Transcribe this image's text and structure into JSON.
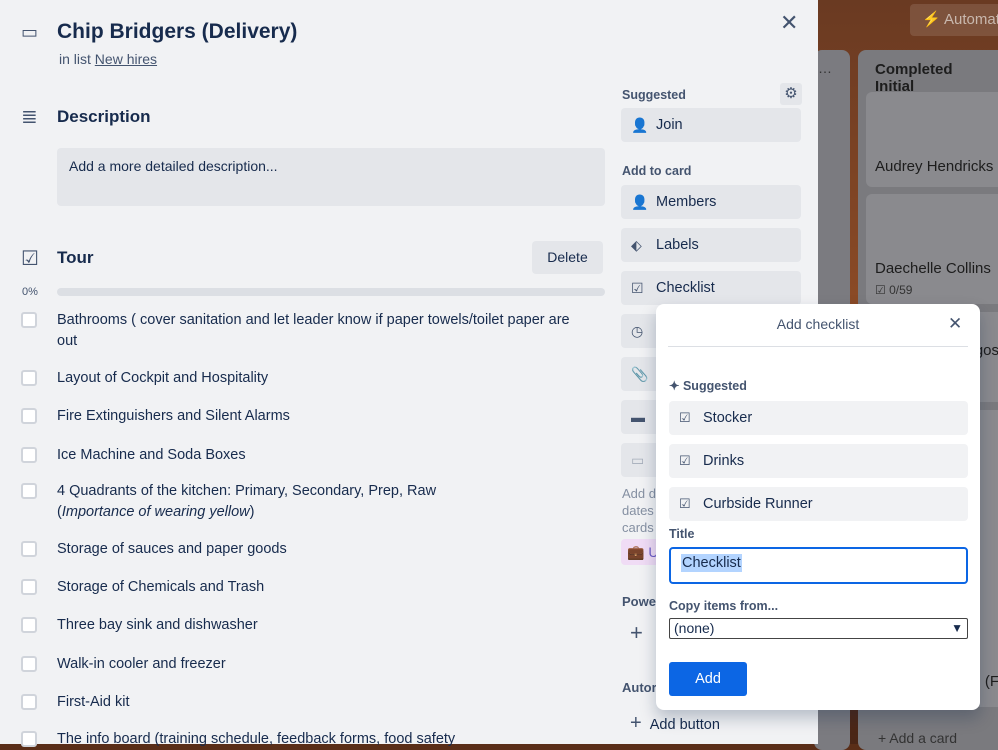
{
  "board": {
    "automation_label": "Automat",
    "list2_title": "Completed Initial",
    "cards": [
      {
        "title": "Audrey Hendricks"
      },
      {
        "title": "Daechelle Collins",
        "badge": "0/59"
      },
      {
        "title": "gos"
      },
      {
        "title": "(F"
      },
      {
        "title": "(F"
      }
    ],
    "add_card": "+ Add a card"
  },
  "card": {
    "title": "Chip Bridgers (Delivery)",
    "in_list_prefix": "in list",
    "list_name": "New hires"
  },
  "description": {
    "heading": "Description",
    "placeholder": "Add a more detailed description..."
  },
  "checklist": {
    "title": "Tour",
    "delete_label": "Delete",
    "progress_label": "0%",
    "progress": 0,
    "items": [
      {
        "text": "Bathrooms ( cover sanitation and let leader know if paper towels/toilet paper are out"
      },
      {
        "text": "Layout of Cockpit and Hospitality"
      },
      {
        "text": "Fire Extinguishers and Silent Alarms"
      },
      {
        "text": "Ice Machine and Soda Boxes"
      },
      {
        "text": "4 Quadrants of the kitchen: Primary, Secondary, Prep, Raw",
        "text_em": "Importance of wearing yellow"
      },
      {
        "text": "Storage of sauces and paper goods"
      },
      {
        "text": "Storage of Chemicals and Trash"
      },
      {
        "text": "Three bay sink and dishwasher"
      },
      {
        "text": "Walk-in cooler and freezer"
      },
      {
        "text": "First-Aid kit"
      },
      {
        "text": "The info board (training schedule, feedback forms, food safety"
      }
    ]
  },
  "sidebar": {
    "suggested_label": "Suggested",
    "join": "Join",
    "add_to_card_label": "Add to card",
    "members": "Members",
    "labels": "Labels",
    "checklist": "Checklist",
    "add_text": "Add d\ndates\ncards",
    "upgrade": "U",
    "power_label": "Powe",
    "automation_label": "Autor",
    "add_button": "Add button"
  },
  "popover": {
    "title": "Add checklist",
    "suggested_label": "Suggested",
    "suggestions": [
      "Stocker",
      "Drinks",
      "Curbside Runner"
    ],
    "title_label": "Title",
    "title_value": "Checklist",
    "copy_label": "Copy items from...",
    "copy_value": "(none)",
    "add_label": "Add"
  }
}
